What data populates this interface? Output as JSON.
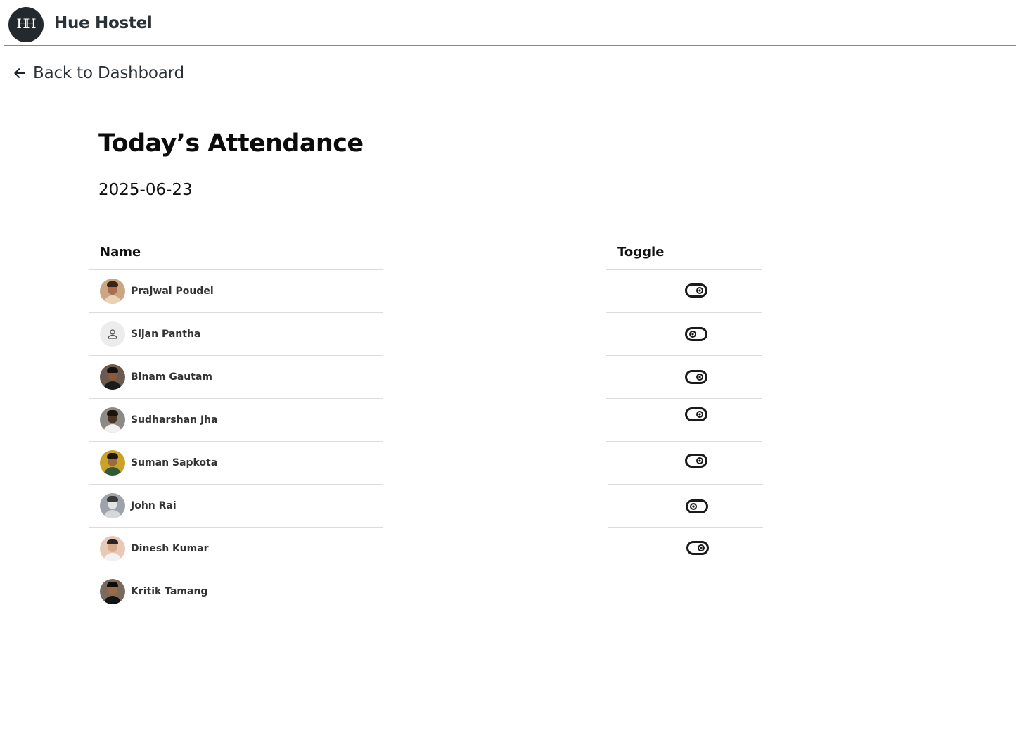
{
  "header": {
    "logo_text": "HH",
    "brand": "Hue Hostel"
  },
  "nav": {
    "back_label": "Back to Dashboard"
  },
  "page": {
    "title": "Today’s Attendance",
    "date": "2025-06-23"
  },
  "table": {
    "headers": {
      "name": "Name",
      "toggle": "Toggle"
    },
    "rows": [
      {
        "name": "Prajwal Poudel",
        "avatar": "photo",
        "toggle": "on"
      },
      {
        "name": "Sijan Pantha",
        "avatar": "placeholder-person-icon",
        "toggle": "off"
      },
      {
        "name": "Binam Gautam",
        "avatar": "photo",
        "toggle": "on"
      },
      {
        "name": "Sudharshan Jha",
        "avatar": "photo",
        "toggle": "on"
      },
      {
        "name": "Suman Sapkota",
        "avatar": "photo",
        "toggle": "on"
      },
      {
        "name": "John Rai",
        "avatar": "photo",
        "toggle": "off"
      },
      {
        "name": "Dinesh Kumar",
        "avatar": "photo",
        "toggle": "on"
      },
      {
        "name": "Kritik Tamang",
        "avatar": "photo",
        "toggle": null
      }
    ]
  },
  "colors": {
    "logo_bg": "#24292d",
    "text_dark": "#2a3238",
    "divider": "#dcdcdc",
    "toggle": "#1a1a1a"
  }
}
